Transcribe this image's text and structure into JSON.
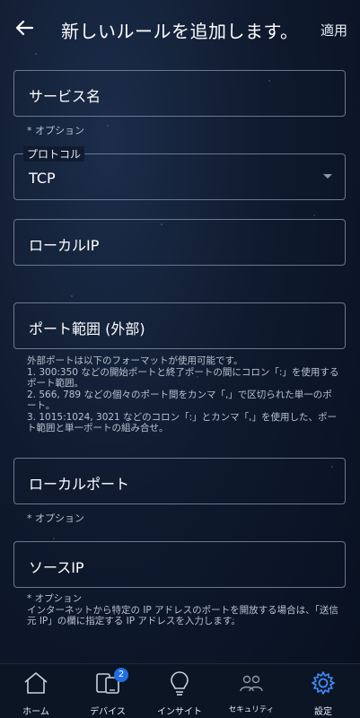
{
  "header": {
    "title": "新しいルールを追加します。",
    "apply_label": "適用"
  },
  "form": {
    "service_name": {
      "value": "サービス名",
      "hint": "* オプション"
    },
    "protocol": {
      "legend": "プロトコル",
      "value": "TCP"
    },
    "local_ip": {
      "value": "ローカルIP"
    },
    "port_range": {
      "value": "ポート範囲 (外部)",
      "help": "外部ポートは以下のフォーマットが使用可能です。\n1. 300:350 などの開始ポートと終了ポートの間にコロン「:」を使用するポート範囲。\n2. 566, 789 などの個々のポート間をカンマ「,」で区切られた単一のポート。\n3. 1015:1024, 3021 などのコロン「:」とカンマ「,」を使用した、ポート範囲と単一ポートの組み合せ。"
    },
    "local_port": {
      "value": "ローカルポート",
      "hint": "* オプション"
    },
    "source_ip": {
      "value": "ソースIP",
      "help": "* オプション\nインターネットから特定の IP アドレスのポートを開放する場合は、「送信元 IP」の欄に指定する IP アドレスを入力します。"
    }
  },
  "tabs": [
    {
      "label": "ホーム",
      "icon": "home-icon"
    },
    {
      "label": "デバイス",
      "icon": "devices-icon",
      "badge": "2"
    },
    {
      "label": "インサイト",
      "icon": "lightbulb-icon"
    },
    {
      "label": "セキュリティ",
      "icon": "users-icon"
    },
    {
      "label": "設定",
      "icon": "gear-icon"
    }
  ],
  "colors": {
    "accent": "#1f6fe0",
    "active_tab": "#3f8cff"
  }
}
